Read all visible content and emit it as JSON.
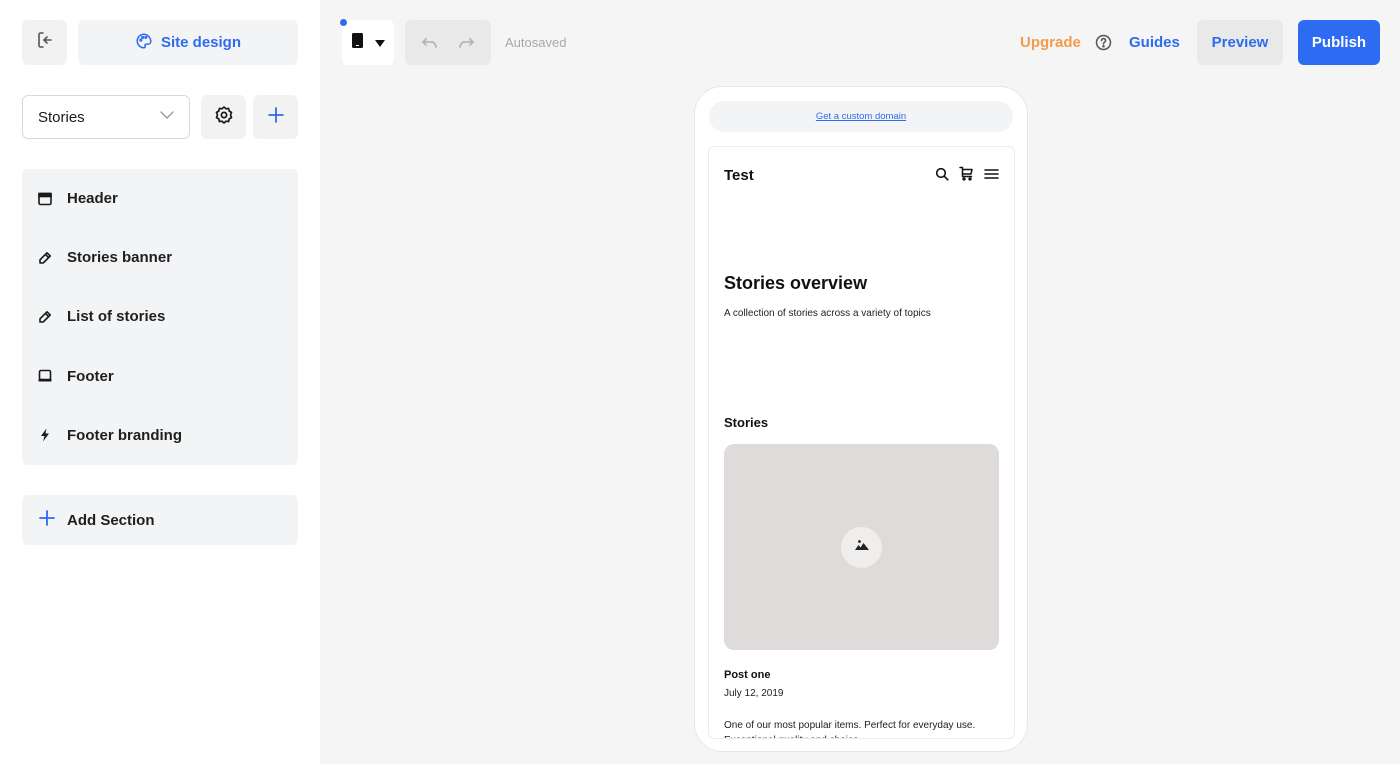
{
  "sidebar": {
    "exit_icon": "exit-icon",
    "site_design": {
      "label": "Site design",
      "icon": "palette-icon"
    },
    "page_select": {
      "value": "Stories",
      "icon": "chevron-down-icon"
    },
    "settings_icon": "gear-icon",
    "add_page_icon": "plus-icon",
    "sections": [
      {
        "label": "Header",
        "icon": "header-layout-icon"
      },
      {
        "label": "Stories banner",
        "icon": "pencil-icon"
      },
      {
        "label": "List of stories",
        "icon": "pencil-icon"
      },
      {
        "label": "Footer",
        "icon": "footer-layout-icon"
      },
      {
        "label": "Footer branding",
        "icon": "lightning-icon"
      }
    ],
    "add_section": {
      "label": "Add Section",
      "icon": "plus-icon"
    }
  },
  "toolbar": {
    "device_icon": "mobile-device-icon",
    "autosave_status": "Autosaved",
    "upgrade": "Upgrade",
    "guides": "Guides",
    "preview": "Preview",
    "publish": "Publish",
    "colors": {
      "accent": "#2d6bf2",
      "upgrade": "#f29c4a"
    }
  },
  "preview": {
    "domain_link": "Get a custom domain",
    "site_title": "Test",
    "banner": {
      "title": "Stories overview",
      "subtitle": "A collection of stories across a variety of topics"
    },
    "stories_heading": "Stories",
    "posts": [
      {
        "title": "Post one",
        "date": "July 12, 2019",
        "description": "One of our most popular items. Perfect for everyday use. Exceptional quality and choice."
      }
    ]
  }
}
